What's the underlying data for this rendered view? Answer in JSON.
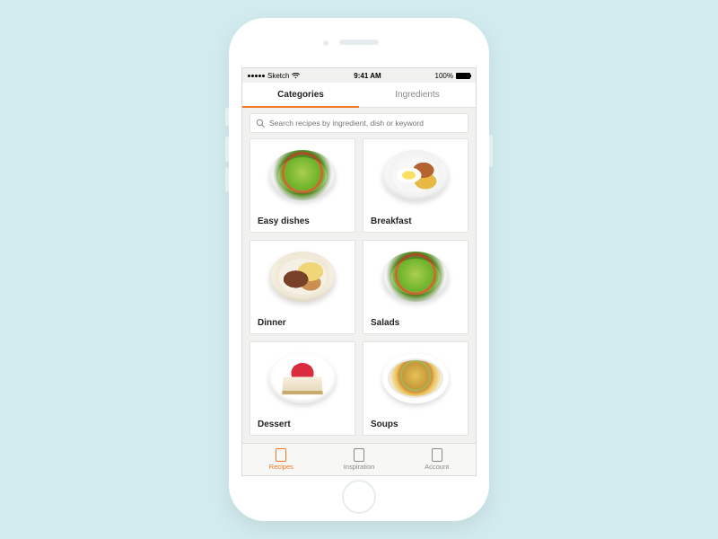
{
  "status": {
    "carrier": "Sketch",
    "time": "9:41 AM",
    "battery_pct": "100%"
  },
  "tabs": {
    "categories": "Categories",
    "ingredients": "Ingredients"
  },
  "search": {
    "placeholder": "Search recipes by ingredient, dish or keyword"
  },
  "categories": [
    {
      "label": "Easy dishes",
      "art": "salad"
    },
    {
      "label": "Breakfast",
      "art": "breakfast"
    },
    {
      "label": "Dinner",
      "art": "dinner"
    },
    {
      "label": "Salads",
      "art": "salad"
    },
    {
      "label": "Dessert",
      "art": "dessert"
    },
    {
      "label": "Soups",
      "art": "bowl"
    }
  ],
  "tabbar": {
    "recipes": "Recipes",
    "inspiration": "Inspiration",
    "account": "Account"
  },
  "colors": {
    "accent": "#ef7722",
    "bg": "#f1f1ef",
    "card_border": "#e3e3e1"
  }
}
